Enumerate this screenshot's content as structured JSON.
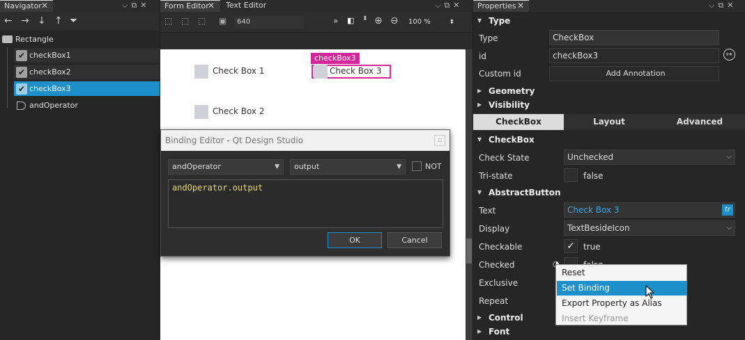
{
  "navigator": {
    "tab": "Navigator",
    "root": "Rectangle",
    "items": [
      {
        "label": "checkBox1"
      },
      {
        "label": "checkBox2"
      },
      {
        "label": "checkBox3"
      },
      {
        "label": "andOperator"
      }
    ]
  },
  "form_editor": {
    "tab_form": "Form Editor",
    "tab_text": "Text Editor",
    "width_value": "640",
    "zoom": "100 %",
    "selection_tag": "checkBox3",
    "checkboxes": [
      "Check Box 1",
      "Check Box 2",
      "Check Box 3"
    ]
  },
  "dialog": {
    "title": "Binding Editor - Qt Design Studio",
    "item_combo": "andOperator",
    "property_combo": "output",
    "not_label": "NOT",
    "expression": "andOperator.output",
    "ok": "OK",
    "cancel": "Cancel"
  },
  "properties": {
    "tab": "Properties",
    "type_section": "Type",
    "type_label": "Type",
    "type_value": "CheckBox",
    "id_label": "id",
    "id_value": "checkBox3",
    "custom_id_label": "Custom id",
    "add_annotation": "Add Annotation",
    "geometry": "Geometry",
    "visibility": "Visibility",
    "tabs": [
      "CheckBox",
      "Layout",
      "Advanced"
    ],
    "checkbox_section": "CheckBox",
    "check_state_label": "Check State",
    "check_state_value": "Unchecked",
    "tristate_label": "Tri-state",
    "tristate_value": "false",
    "abstract_section": "AbstractButton",
    "text_label": "Text",
    "text_value": "Check Box 3",
    "tr_badge": "tr",
    "display_label": "Display",
    "display_value": "TextBesideIcon",
    "checkable_label": "Checkable",
    "checkable_value": "true",
    "checked_label": "Checked",
    "checked_value": "false",
    "exclusive_label": "Exclusive",
    "repeat_label": "Repeat",
    "control_section": "Control",
    "font_section": "Font"
  },
  "context_menu": {
    "items": [
      "Reset",
      "Set Binding",
      "Export Property as Alias",
      "Insert Keyframe"
    ]
  },
  "colors": {
    "accent": "#1d8fc9",
    "selection_magenta": "#d4259a"
  }
}
